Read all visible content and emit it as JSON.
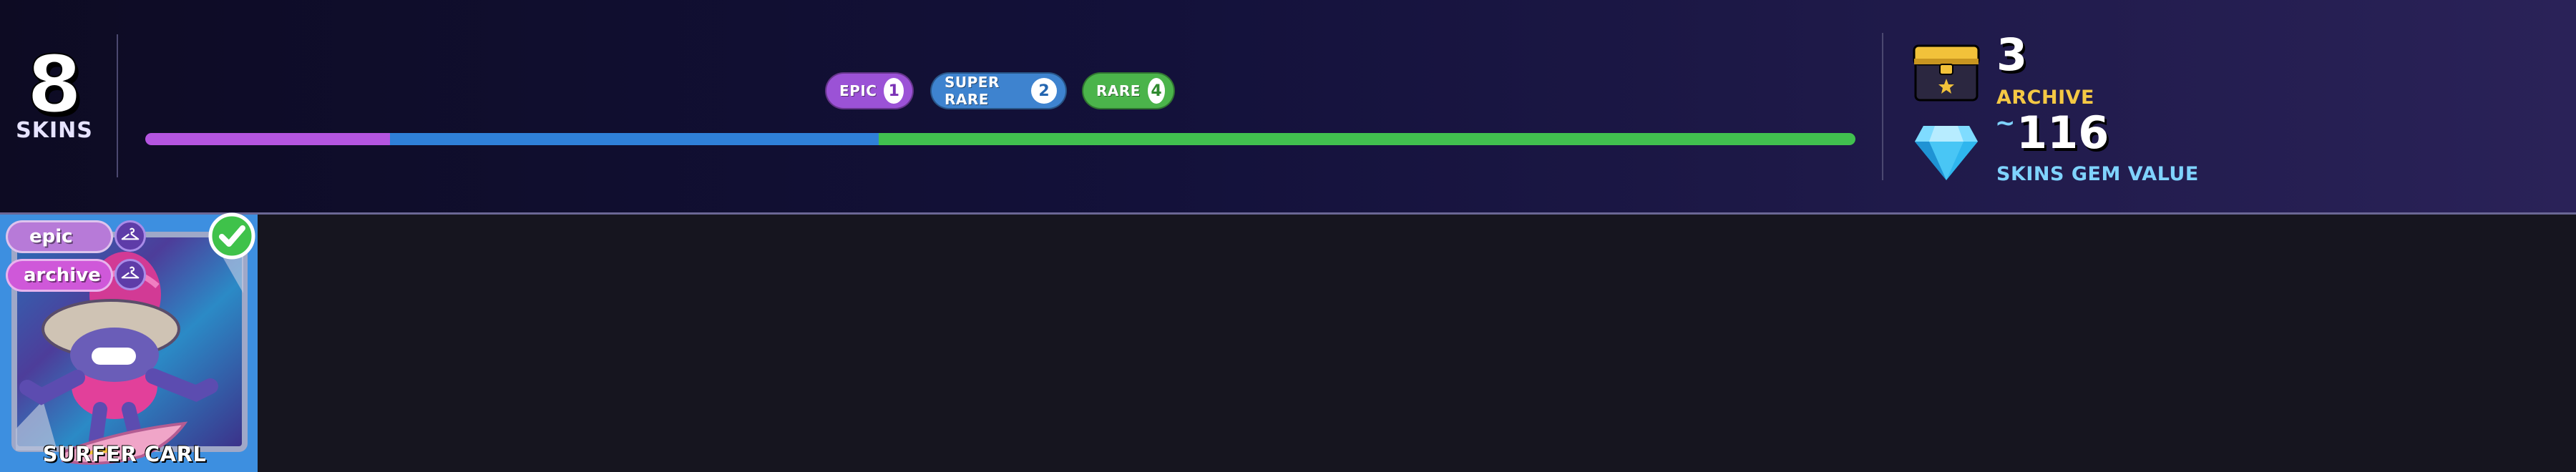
{
  "summary": {
    "count": "8",
    "label": "SKINS"
  },
  "rarities": [
    {
      "key": "epic",
      "label": "EPIC",
      "count": "1",
      "color": "#9b52d6"
    },
    {
      "key": "super_rare",
      "label": "SUPER RARE",
      "count": "2",
      "color": "#3e83cf"
    },
    {
      "key": "rare",
      "label": "RARE",
      "count": "4",
      "color": "#4bb44b"
    }
  ],
  "rarity_bar": [
    {
      "key": "epic",
      "fraction": 0.143,
      "color": "#b455e0"
    },
    {
      "key": "super_rare",
      "fraction": 0.286,
      "color": "#2f80d8"
    },
    {
      "key": "rare",
      "fraction": 0.571,
      "color": "#41c04f"
    }
  ],
  "stats": {
    "archive": {
      "value": "3",
      "label": "ARCHIVE",
      "icon": "archive-chest-icon",
      "color": "#f4c844"
    },
    "gems": {
      "prefix": "~",
      "value": "116",
      "label": "SKINS GEM VALUE",
      "icon": "gem-icon",
      "color": "#7fd3ff"
    }
  },
  "cards": [
    {
      "name": "SURFER CARL",
      "tags": [
        "epic",
        "archive"
      ],
      "tag_icon": "hanger-icon",
      "status_icon": "check-icon",
      "background": "#3d8fe0"
    }
  ]
}
